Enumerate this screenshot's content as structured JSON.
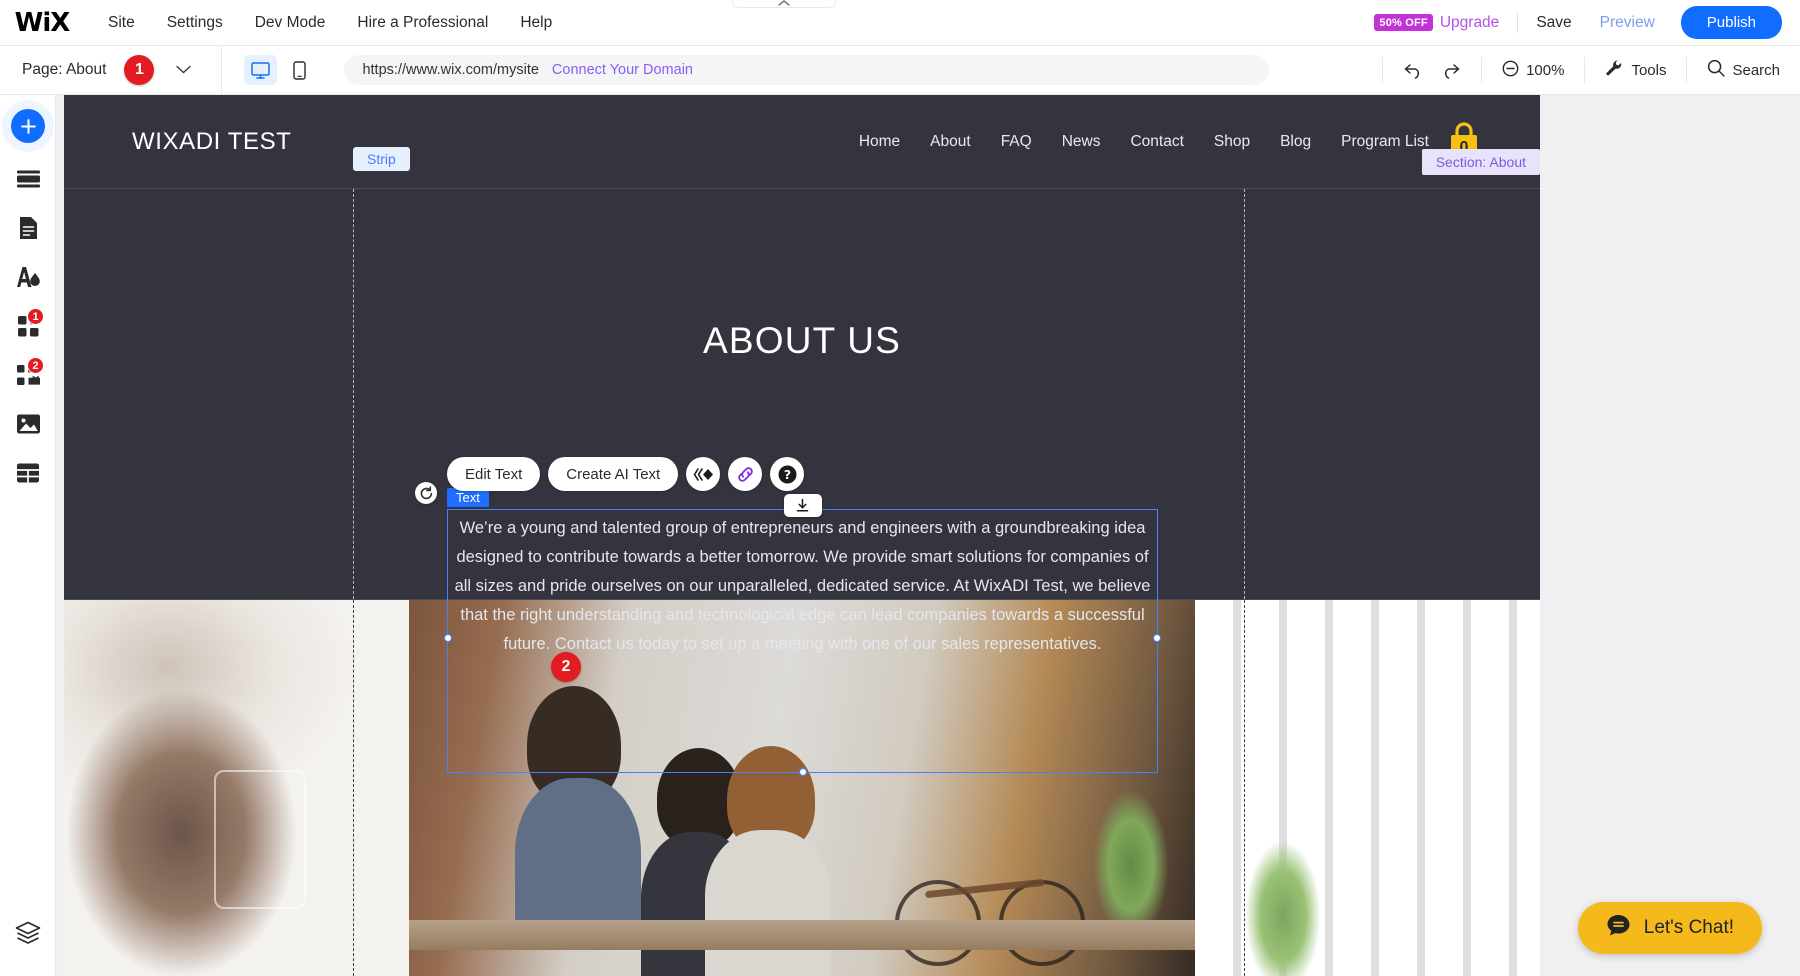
{
  "topbar": {
    "logo": "WiX",
    "menu": [
      "Site",
      "Settings",
      "Dev Mode",
      "Hire a Professional",
      "Help"
    ],
    "discount_badge": "50% OFF",
    "upgrade": "Upgrade",
    "save": "Save",
    "preview": "Preview",
    "publish": "Publish"
  },
  "subbar": {
    "page_label": "Page: About",
    "page_badge": "1",
    "chevron": "⌄",
    "url": "https://www.wix.com/mysite",
    "connect_domain": "Connect Your Domain",
    "zoom": "100%",
    "tools": "Tools",
    "search": "Search",
    "icons": {
      "desktop": "desktop-icon",
      "mobile": "mobile-icon",
      "undo": "undo-icon",
      "redo": "redo-icon",
      "zoom_out": "zoom-out-icon",
      "tools": "wrench-icon",
      "search": "search-icon"
    }
  },
  "rail": {
    "items": [
      {
        "name": "add-element",
        "icon": "plus-icon",
        "badge": null
      },
      {
        "name": "add-section",
        "icon": "section-icon",
        "badge": null
      },
      {
        "name": "pages-menu",
        "icon": "page-icon",
        "badge": null
      },
      {
        "name": "site-design",
        "icon": "theme-icon",
        "badge": null
      },
      {
        "name": "app-market",
        "icon": "apps-grid-icon",
        "badge": "1"
      },
      {
        "name": "my-business",
        "icon": "puzzle-icon",
        "badge": "2"
      },
      {
        "name": "media-manager",
        "icon": "image-icon",
        "badge": null
      },
      {
        "name": "my-designs",
        "icon": "table-icon",
        "badge": null
      }
    ],
    "bottom": {
      "name": "layers",
      "icon": "layers-icon"
    }
  },
  "site": {
    "logo": "WIXADI TEST",
    "nav": [
      "Home",
      "About",
      "FAQ",
      "News",
      "Contact",
      "Shop",
      "Blog",
      "Program List"
    ],
    "cart_count": "0",
    "strip_tag": "Strip",
    "section_tag": "Section: About",
    "heading": "ABOUT US",
    "paragraph": "We’re a young and talented group of entrepreneurs and engineers with a groundbreaking idea designed to contribute towards a better tomorrow. We provide smart solutions for companies of all sizes and pride ourselves on our unparalleled, dedicated service. At WixADI Test, we believe that the right understanding and technological edge can lead companies towards a successful future. Contact us today to set up a meeting with one of our sales representatives.",
    "text_tag": "Text",
    "element_badge": "2"
  },
  "editor_toolbar": {
    "edit_text": "Edit Text",
    "create_ai_text": "Create AI Text",
    "animation_icon": "animation-icon",
    "link_icon": "link-icon",
    "help_icon": "help-icon",
    "rotate_icon": "rotate-icon",
    "download_icon": "download-icon"
  },
  "chat": {
    "label": "Let's Chat!",
    "icon": "chat-bubble-icon"
  },
  "colors": {
    "accent_blue": "#116dff",
    "upgrade_purple": "#b550e8",
    "badge_magenta": "#c332d6",
    "red_badge": "#e21c21",
    "site_bg": "#34343f",
    "selection_blue": "#4a7dff",
    "chat_yellow": "#f5b91c",
    "cart_yellow": "#f5c116",
    "section_tag_purple": "#7b5ce0"
  }
}
